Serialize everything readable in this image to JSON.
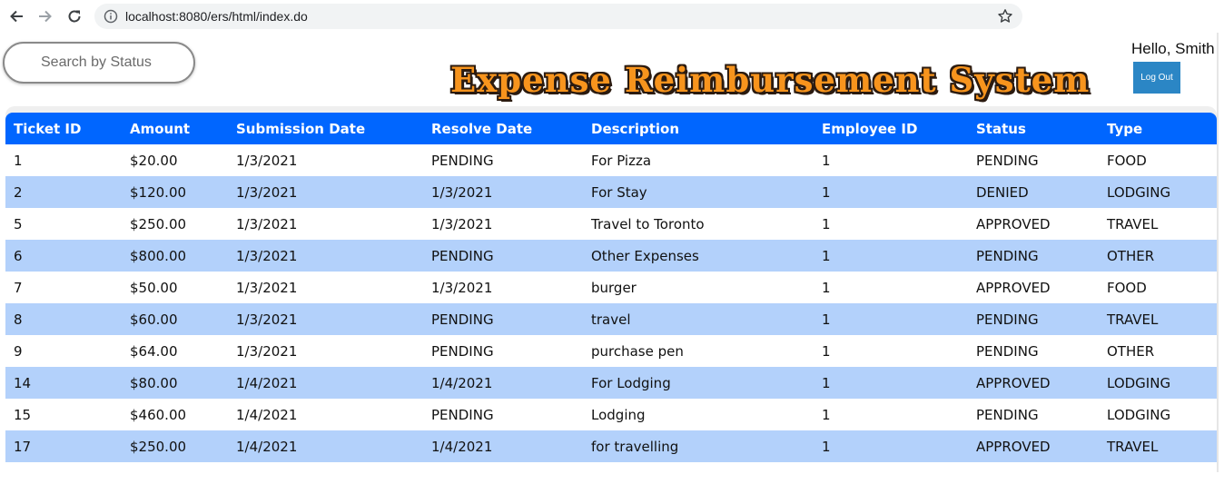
{
  "browser": {
    "url": "localhost:8080/ers/html/index.do"
  },
  "header": {
    "search_placeholder": "Search by Status",
    "title": "Expense Reimbursement System",
    "greeting": "Hello, Smith",
    "logout_label": "Log Out"
  },
  "colors": {
    "table_header_bg": "#0066ff",
    "row_alt_bg": "#b3d1fb",
    "title_color": "#f7941d",
    "logout_bg": "#2b86c5"
  },
  "table": {
    "columns": [
      "Ticket ID",
      "Amount",
      "Submission Date",
      "Resolve Date",
      "Description",
      "Employee ID",
      "Status",
      "Type"
    ],
    "rows": [
      [
        "1",
        "$20.00",
        "1/3/2021",
        "PENDING",
        "For Pizza",
        "1",
        "PENDING",
        "FOOD"
      ],
      [
        "2",
        "$120.00",
        "1/3/2021",
        "1/3/2021",
        "For Stay",
        "1",
        "DENIED",
        "LODGING"
      ],
      [
        "5",
        "$250.00",
        "1/3/2021",
        "1/3/2021",
        "Travel to Toronto",
        "1",
        "APPROVED",
        "TRAVEL"
      ],
      [
        "6",
        "$800.00",
        "1/3/2021",
        "PENDING",
        "Other Expenses",
        "1",
        "PENDING",
        "OTHER"
      ],
      [
        "7",
        "$50.00",
        "1/3/2021",
        "1/3/2021",
        "burger",
        "1",
        "APPROVED",
        "FOOD"
      ],
      [
        "8",
        "$60.00",
        "1/3/2021",
        "PENDING",
        "travel",
        "1",
        "PENDING",
        "TRAVEL"
      ],
      [
        "9",
        "$64.00",
        "1/3/2021",
        "PENDING",
        "purchase pen",
        "1",
        "PENDING",
        "OTHER"
      ],
      [
        "14",
        "$80.00",
        "1/4/2021",
        "1/4/2021",
        "For Lodging",
        "1",
        "APPROVED",
        "LODGING"
      ],
      [
        "15",
        "$460.00",
        "1/4/2021",
        "PENDING",
        "Lodging",
        "1",
        "PENDING",
        "LODGING"
      ],
      [
        "17",
        "$250.00",
        "1/4/2021",
        "1/4/2021",
        "for travelling",
        "1",
        "APPROVED",
        "TRAVEL"
      ]
    ]
  }
}
